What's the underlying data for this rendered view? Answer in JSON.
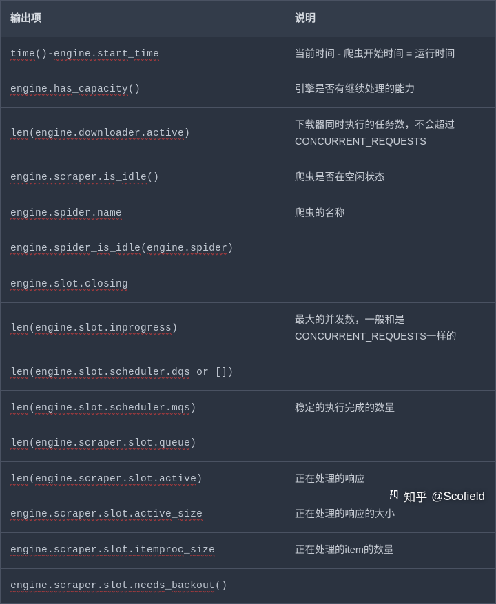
{
  "headers": {
    "col0": "输出项",
    "col1": "说明"
  },
  "rows": [
    {
      "c0": [
        {
          "t": "time",
          "s": true
        },
        {
          "t": "()-"
        },
        {
          "t": "engine.start",
          "s": true
        },
        {
          "t": "_"
        },
        {
          "t": "time",
          "s": true
        }
      ],
      "c1": "当前时间 - 爬虫开始时间 = 运行时间"
    },
    {
      "c0": [
        {
          "t": "engine.has",
          "s": true
        },
        {
          "t": "_"
        },
        {
          "t": "capacity",
          "s": true
        },
        {
          "t": "()"
        }
      ],
      "c1": "引擎是否有继续处理的能力"
    },
    {
      "c0": [
        {
          "t": "len",
          "s": true
        },
        {
          "t": "("
        },
        {
          "t": "engine.downloader.active",
          "s": true
        },
        {
          "t": ")"
        }
      ],
      "c1": "下载器同时执行的任务数，不会超过CONCURRENT_REQUESTS"
    },
    {
      "c0": [
        {
          "t": "engine.scraper.is",
          "s": true
        },
        {
          "t": "_"
        },
        {
          "t": "idle",
          "s": true
        },
        {
          "t": "()"
        }
      ],
      "c1": "爬虫是否在空闲状态"
    },
    {
      "c0": [
        {
          "t": "engine.spider.name",
          "s": true
        }
      ],
      "c1": "爬虫的名称"
    },
    {
      "c0": [
        {
          "t": "engine.spider",
          "s": true
        },
        {
          "t": "_"
        },
        {
          "t": "is",
          "s": true
        },
        {
          "t": "_"
        },
        {
          "t": "idle",
          "s": true
        },
        {
          "t": "("
        },
        {
          "t": "engine.spider",
          "s": true
        },
        {
          "t": ")"
        }
      ],
      "c1": ""
    },
    {
      "c0": [
        {
          "t": "engine.slot.closing",
          "s": true
        }
      ],
      "c1": ""
    },
    {
      "c0": [
        {
          "t": "len",
          "s": true
        },
        {
          "t": "("
        },
        {
          "t": "engine.slot.inprogress",
          "s": true
        },
        {
          "t": ")"
        }
      ],
      "c1": "最大的并发数，一般和是CONCURRENT_REQUESTS一样的"
    },
    {
      "c0": [
        {
          "t": "len",
          "s": true
        },
        {
          "t": "("
        },
        {
          "t": "engine.slot.scheduler.dqs",
          "s": true
        },
        {
          "t": " or [])"
        }
      ],
      "c1": ""
    },
    {
      "c0": [
        {
          "t": "len",
          "s": true
        },
        {
          "t": "("
        },
        {
          "t": "engine.slot.scheduler.mqs",
          "s": true
        },
        {
          "t": ")"
        }
      ],
      "c1": "稳定的执行完成的数量"
    },
    {
      "c0": [
        {
          "t": "len",
          "s": true
        },
        {
          "t": "("
        },
        {
          "t": "engine.scraper.slot.queue",
          "s": true
        },
        {
          "t": ")"
        }
      ],
      "c1": ""
    },
    {
      "c0": [
        {
          "t": "len",
          "s": true
        },
        {
          "t": "("
        },
        {
          "t": "engine.scraper.slot.active",
          "s": true
        },
        {
          "t": ")"
        }
      ],
      "c1": "正在处理的响应"
    },
    {
      "c0": [
        {
          "t": "engine.scraper.slot.active",
          "s": true
        },
        {
          "t": "_"
        },
        {
          "t": "size",
          "s": true
        }
      ],
      "c1": "正在处理的响应的大小"
    },
    {
      "c0": [
        {
          "t": "engine.scraper.slot.itemproc",
          "s": true
        },
        {
          "t": "_"
        },
        {
          "t": "size",
          "s": true
        }
      ],
      "c1": "正在处理的item的数量"
    },
    {
      "c0": [
        {
          "t": "engine.scraper.slot.needs",
          "s": true
        },
        {
          "t": "_"
        },
        {
          "t": "backout",
          "s": true
        },
        {
          "t": "()"
        }
      ],
      "c1": ""
    }
  ],
  "watermark": {
    "brand": "知乎",
    "handle": "@Scofield"
  }
}
